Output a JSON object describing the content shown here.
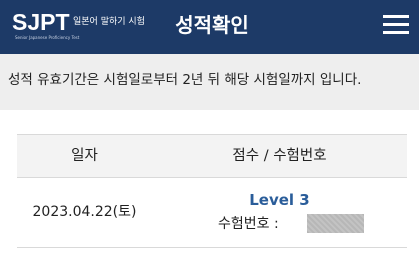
{
  "header": {
    "logo_mark": "SJPT",
    "logo_subtitle": "일본어 말하기 시험",
    "logo_english": "Senior Japanese Proficiency Test",
    "title": "성적확인",
    "menu_icon": "hamburger-icon"
  },
  "notice": {
    "text": "성적 유효기간은 시험일로부터 2년 뒤 해당 시험일까지 입니다."
  },
  "table": {
    "headers": {
      "date": "일자",
      "score": "점수 / 수험번호"
    },
    "rows": [
      {
        "date": "2023.04.22(토)",
        "level": "Level 3",
        "exam_number_label": "수험번호 :",
        "exam_number": ""
      }
    ]
  },
  "colors": {
    "header_bg": "#1d3a67",
    "accent": "#2a5d9a",
    "notice_bg": "#eeeeee"
  }
}
